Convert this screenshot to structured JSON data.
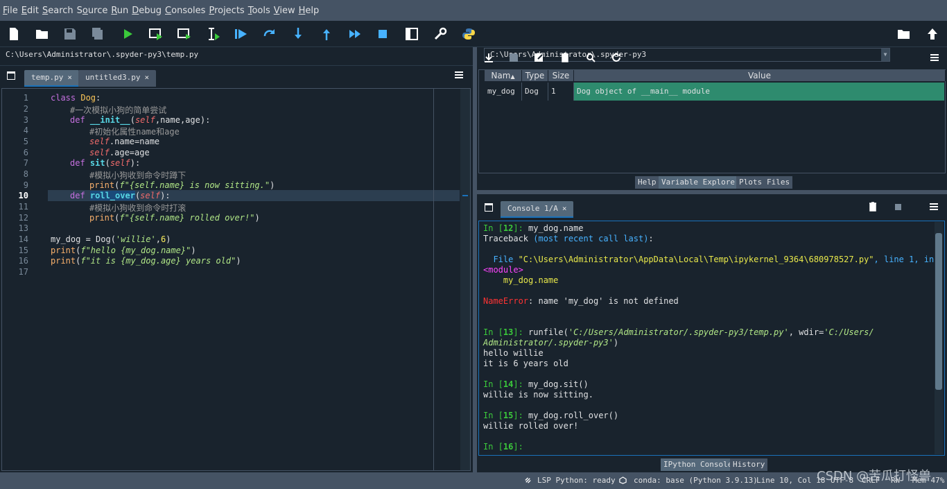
{
  "menu": [
    "File",
    "Edit",
    "Search",
    "Source",
    "Run",
    "Debug",
    "Consoles",
    "Projects",
    "Tools",
    "View",
    "Help"
  ],
  "menu_accel": [
    "F",
    "E",
    "S",
    "S",
    "R",
    "D",
    "C",
    "P",
    "T",
    "V",
    "H"
  ],
  "working_dir": "C:\\Users\\Administrator\\.spyder-py3",
  "editor": {
    "filepath": "C:\\Users\\Administrator\\.spyder-py3\\temp.py",
    "tabs": [
      {
        "label": "temp.py",
        "close": "×"
      },
      {
        "label": "untitled3.py",
        "close": "×"
      }
    ],
    "current_line": 10,
    "line_numbers": [
      "1",
      "2",
      "3",
      "4",
      "5",
      "6",
      "7",
      "8",
      "9",
      "10",
      "11",
      "12",
      "13",
      "14",
      "15",
      "16",
      "17"
    ]
  },
  "code": {
    "l1": [
      "class ",
      "Dog",
      ":"
    ],
    "l2": "#一次模拟小狗的简单尝试",
    "l3": [
      "def ",
      "__init__",
      "(",
      "self",
      ",name,age):"
    ],
    "l4": "#初始化属性name和age",
    "l5": [
      "self",
      ".name=name"
    ],
    "l6": [
      "self",
      ".age=age"
    ],
    "l7": [
      "def ",
      "sit",
      "(",
      "self",
      "):"
    ],
    "l8": "#模拟小狗收到命令时蹲下",
    "l9": [
      "print",
      "(",
      "f\"{self.name} is now sitting.\"",
      ")"
    ],
    "l10": [
      "def ",
      "roll_over",
      "(",
      "self",
      "):"
    ],
    "l11": "#模拟小狗收到命令时打滚",
    "l12": [
      "print",
      "(",
      "f\"{self.name} rolled over!\"",
      ")"
    ],
    "l14": [
      "my_dog = Dog(",
      "'willie'",
      ",",
      "6",
      ")"
    ],
    "l15": [
      "print",
      "(",
      "f\"hello {my_dog.name}\"",
      ")"
    ],
    "l16": [
      "print",
      "(",
      "f\"it is {my_dog.age} years old\"",
      ")"
    ]
  },
  "variable_explorer": {
    "headers": [
      "Nam",
      "Type",
      "Size",
      "Value"
    ],
    "rows": [
      {
        "name": "my_dog",
        "type": "Dog",
        "size": "1",
        "value": "Dog object of __main__ module"
      }
    ],
    "value_bg": "#2e8b6e"
  },
  "pane_tabs_top": [
    "Help",
    "Variable Explorer",
    "Plots",
    "Files"
  ],
  "console": {
    "tab": "Console 1/A",
    "close": "×",
    "lines": {
      "in12_p": "In [",
      "in12_n": "12",
      "in12_s": "]: ",
      "in12_c": "my_dog.name",
      "tb1": "Traceback ",
      "tb2": "(most recent call last)",
      "tb3": ":",
      "file1": "  File ",
      "file2": "\"C:\\Users\\Administrator\\AppData\\Local\\Temp\\ipykernel_9364\\680978527.py\"",
      "file3": ", line 1, in",
      "module": "<module>",
      "modcode": "    my_dog.name",
      "err1": "NameError",
      "err2": ": name 'my_dog' is not defined",
      "in13_n": "13",
      "in13_c1": "runfile(",
      "in13_c2": "'C:/Users/Administrator/.spyder-py3/temp.py'",
      "in13_c3": ", wdir=",
      "in13_c4": "'C:/Users/",
      "in13_c5": "Administrator/.spyder-py3'",
      "in13_c6": ")",
      "out1": "hello willie",
      "out2": "it is 6 years old",
      "in14_n": "14",
      "in14_c": "my_dog.sit()",
      "out3": "willie is now sitting.",
      "in15_n": "15",
      "in15_c": "my_dog.roll_over()",
      "out4": "willie rolled over!",
      "in16_n": "16",
      "in16_s": "]:"
    }
  },
  "pane_tabs_bottom": [
    "IPython Console",
    "History"
  ],
  "status": {
    "lsp": "LSP Python: ready",
    "conda": "conda: base (Python 3.9.13)",
    "pos": "Line 10, Col 18",
    "enc": "UTF-8",
    "eol": "CRLF",
    "rw": "RW",
    "mem": "Mem 47%"
  },
  "watermark": "CSDN @苦瓜打怪兽"
}
